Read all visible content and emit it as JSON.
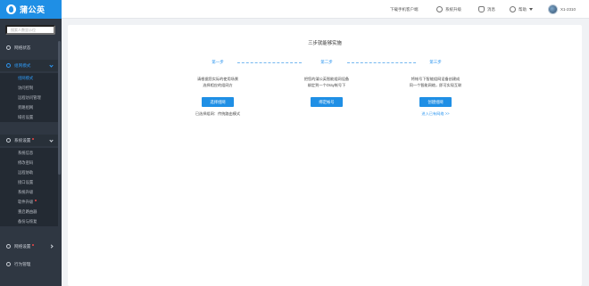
{
  "header": {
    "brand": "蒲公英",
    "download_client": "下载手机客户端",
    "upgrade": "系统升级",
    "messages": "消息",
    "help": "帮助",
    "device": "X1-2310"
  },
  "sidebar": {
    "search_placeholder": "搜索人数显示位",
    "groups": [
      {
        "label": "网络状态"
      },
      {
        "label": "组网模式",
        "items": [
          "组网模式",
          "访问控制",
          "远程访问管理",
          "旁路组网",
          "域名设置"
        ]
      },
      {
        "label": "系统设置",
        "items": [
          "系统信息",
          "修改密码",
          "远程协助",
          "接口设置",
          "系统升级",
          "软件升级",
          "重启路由器",
          "备份与恢复"
        ]
      },
      {
        "label": "网络设置"
      },
      {
        "label": "行为管理"
      }
    ]
  },
  "main": {
    "title": "三步就能够实施",
    "steps": [
      {
        "label": "第一步",
        "desc_line1": "请根据您实际的使用场景",
        "desc_line2": "选择相应的组网方",
        "button": "选择组网",
        "note": "已选择组网：传统路由模式"
      },
      {
        "label": "第二步",
        "desc_line1": "把您的蒲公英智能组网设备",
        "desc_line2": "绑定到一个Oray帐号下",
        "button": "绑定帐号"
      },
      {
        "label": "第三步",
        "desc_line1": "将帐号下智能组网设备创建成",
        "desc_line2": "同一个智能网络，即可实现互联",
        "button": "创建组网",
        "link": "进入已有网络 >>"
      }
    ]
  },
  "colors": {
    "accent": "#1f8fe5",
    "sidebar_bg": "#2f3742",
    "active_text": "#2e97f0"
  }
}
